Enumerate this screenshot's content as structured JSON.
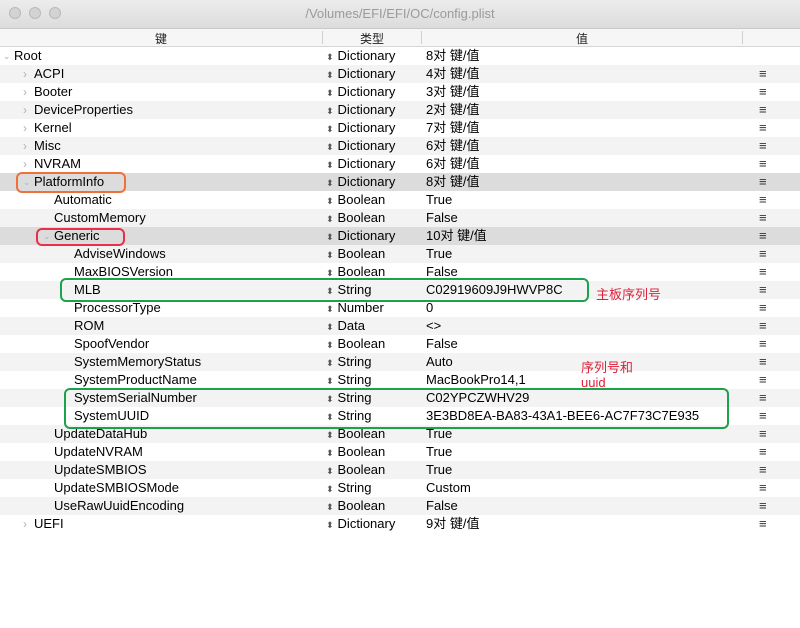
{
  "window": {
    "title": "/Volumes/EFI/EFI/OC/config.plist"
  },
  "columns": {
    "key": "键",
    "type": "类型",
    "value": "值"
  },
  "rows": [
    {
      "key": "Root",
      "type": "Dictionary",
      "value": "8对 键/值",
      "level": 0,
      "disclosure": "open",
      "menu": false
    },
    {
      "key": "ACPI",
      "type": "Dictionary",
      "value": "4对 键/值",
      "level": 1,
      "disclosure": "closed",
      "menu": true
    },
    {
      "key": "Booter",
      "type": "Dictionary",
      "value": "3对 键/值",
      "level": 1,
      "disclosure": "closed",
      "menu": true
    },
    {
      "key": "DeviceProperties",
      "type": "Dictionary",
      "value": "2对 键/值",
      "level": 1,
      "disclosure": "closed",
      "menu": true
    },
    {
      "key": "Kernel",
      "type": "Dictionary",
      "value": "7对 键/值",
      "level": 1,
      "disclosure": "closed",
      "menu": true
    },
    {
      "key": "Misc",
      "type": "Dictionary",
      "value": "6对 键/值",
      "level": 1,
      "disclosure": "closed",
      "menu": true
    },
    {
      "key": "NVRAM",
      "type": "Dictionary",
      "value": "6对 键/值",
      "level": 1,
      "disclosure": "closed",
      "menu": true
    },
    {
      "key": "PlatformInfo",
      "type": "Dictionary",
      "value": "8对 键/值",
      "level": 1,
      "disclosure": "open",
      "menu": true
    },
    {
      "key": "Automatic",
      "type": "Boolean",
      "value": "True",
      "level": 2,
      "disclosure": "none",
      "menu": true
    },
    {
      "key": "CustomMemory",
      "type": "Boolean",
      "value": "False",
      "level": 2,
      "disclosure": "none",
      "menu": true
    },
    {
      "key": "Generic",
      "type": "Dictionary",
      "value": "10对 键/值",
      "level": 2,
      "disclosure": "open",
      "menu": true
    },
    {
      "key": "AdviseWindows",
      "type": "Boolean",
      "value": "True",
      "level": 3,
      "disclosure": "none",
      "menu": true
    },
    {
      "key": "MaxBIOSVersion",
      "type": "Boolean",
      "value": "False",
      "level": 3,
      "disclosure": "none",
      "menu": true
    },
    {
      "key": "MLB",
      "type": "String",
      "value": "C02919609J9HWVP8C",
      "level": 3,
      "disclosure": "none",
      "menu": true
    },
    {
      "key": "ProcessorType",
      "type": "Number",
      "value": "0",
      "level": 3,
      "disclosure": "none",
      "menu": true
    },
    {
      "key": "ROM",
      "type": "Data",
      "value": "<>",
      "level": 3,
      "disclosure": "none",
      "menu": true
    },
    {
      "key": "SpoofVendor",
      "type": "Boolean",
      "value": "False",
      "level": 3,
      "disclosure": "none",
      "menu": true
    },
    {
      "key": "SystemMemoryStatus",
      "type": "String",
      "value": "Auto",
      "level": 3,
      "disclosure": "none",
      "menu": true
    },
    {
      "key": "SystemProductName",
      "type": "String",
      "value": "MacBookPro14,1",
      "level": 3,
      "disclosure": "none",
      "menu": true
    },
    {
      "key": "SystemSerialNumber",
      "type": "String",
      "value": "C02YPCZWHV29",
      "level": 3,
      "disclosure": "none",
      "menu": true
    },
    {
      "key": "SystemUUID",
      "type": "String",
      "value": "3E3BD8EA-BA83-43A1-BEE6-AC7F73C7E935",
      "level": 3,
      "disclosure": "none",
      "menu": true
    },
    {
      "key": "UpdateDataHub",
      "type": "Boolean",
      "value": "True",
      "level": 2,
      "disclosure": "none",
      "menu": true
    },
    {
      "key": "UpdateNVRAM",
      "type": "Boolean",
      "value": "True",
      "level": 2,
      "disclosure": "none",
      "menu": true
    },
    {
      "key": "UpdateSMBIOS",
      "type": "Boolean",
      "value": "True",
      "level": 2,
      "disclosure": "none",
      "menu": true
    },
    {
      "key": "UpdateSMBIOSMode",
      "type": "String",
      "value": "Custom",
      "level": 2,
      "disclosure": "none",
      "menu": true
    },
    {
      "key": "UseRawUuidEncoding",
      "type": "Boolean",
      "value": "False",
      "level": 2,
      "disclosure": "none",
      "menu": true
    },
    {
      "key": "UEFI",
      "type": "Dictionary",
      "value": "9对 键/值",
      "level": 1,
      "disclosure": "closed",
      "menu": true
    }
  ],
  "annotations": {
    "mlb_note": "主板序列号",
    "serial_note_line1": "序列号和",
    "serial_note_line2": "uuid"
  },
  "colors": {
    "orange_box": "#f0703a",
    "red_box": "#e8304a",
    "green_box": "#1aa34a",
    "annotation_text": "#e0203a"
  }
}
